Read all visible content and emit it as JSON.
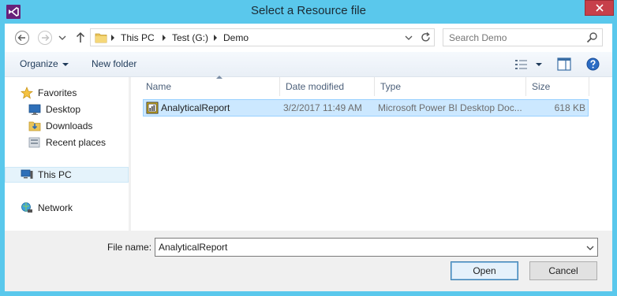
{
  "window": {
    "title": "Select a Resource file"
  },
  "address": {
    "breadcrumbs": [
      "This PC",
      "Test (G:)",
      "Demo"
    ]
  },
  "search": {
    "placeholder": "Search Demo"
  },
  "commands": {
    "organize": "Organize",
    "new_folder": "New folder"
  },
  "nav": {
    "items": [
      {
        "label": "Favorites",
        "icon": "star-icon",
        "group": "favorites"
      },
      {
        "label": "Desktop",
        "icon": "desktop-icon",
        "group": "favorites"
      },
      {
        "label": "Downloads",
        "icon": "downloads-folder-icon",
        "group": "favorites"
      },
      {
        "label": "Recent places",
        "icon": "recent-places-icon",
        "group": "favorites"
      },
      {
        "label": "This PC",
        "icon": "computer-icon",
        "group": "this-pc",
        "selected": true
      },
      {
        "label": "Network",
        "icon": "network-icon",
        "group": "network"
      }
    ]
  },
  "columns": {
    "name": "Name",
    "date": "Date modified",
    "type": "Type",
    "size": "Size"
  },
  "files": [
    {
      "name": "AnalyticalReport",
      "date": "3/2/2017 11:49 AM",
      "type": "Microsoft Power BI Desktop Doc...",
      "size": "618 KB",
      "icon": "power-bi-file-icon"
    }
  ],
  "filename": {
    "label": "File name:",
    "value": "AnalyticalReport"
  },
  "buttons": {
    "open": "Open",
    "cancel": "Cancel"
  },
  "colors": {
    "titlebar": "#5ac8ec",
    "selection": "#cce8ff",
    "close": "#c7404a",
    "command_text": "#1e3a59"
  }
}
